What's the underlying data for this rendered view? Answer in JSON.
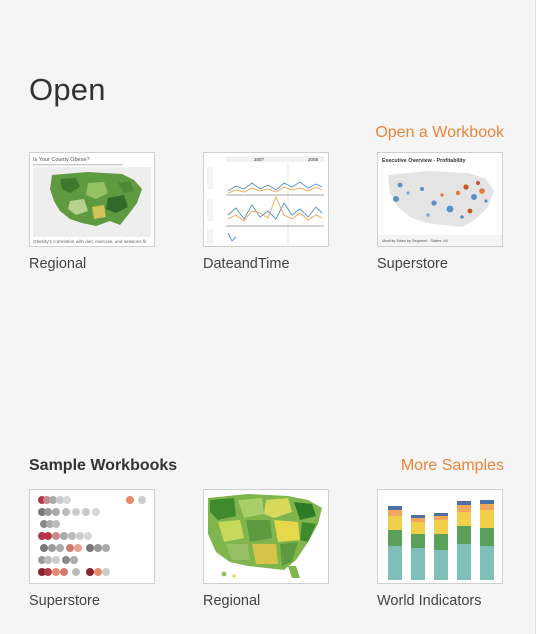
{
  "open": {
    "heading": "Open",
    "open_workbook_link": "Open a Workbook",
    "recent_workbooks": [
      {
        "label": "Regional",
        "thumb_title": "Is Your County Obese?",
        "thumb_caption": "Obesity's correlation with diet, exercise, and sessions fit"
      },
      {
        "label": "DateandTime",
        "thumb_year_1": "2007",
        "thumb_year_2": "2008"
      },
      {
        "label": "Superstore",
        "thumb_title": "Executive Overview - Profitability",
        "thumb_caption": "Monthly Sales by Segment · States: All"
      }
    ]
  },
  "samples": {
    "title": "Sample Workbooks",
    "more_samples_link": "More Samples",
    "workbooks": [
      {
        "label": "Superstore"
      },
      {
        "label": "Regional"
      },
      {
        "label": "World Indicators"
      }
    ]
  },
  "colors": {
    "accent": "#e8853d",
    "text": "#333333",
    "background": "#f5f5f5"
  }
}
